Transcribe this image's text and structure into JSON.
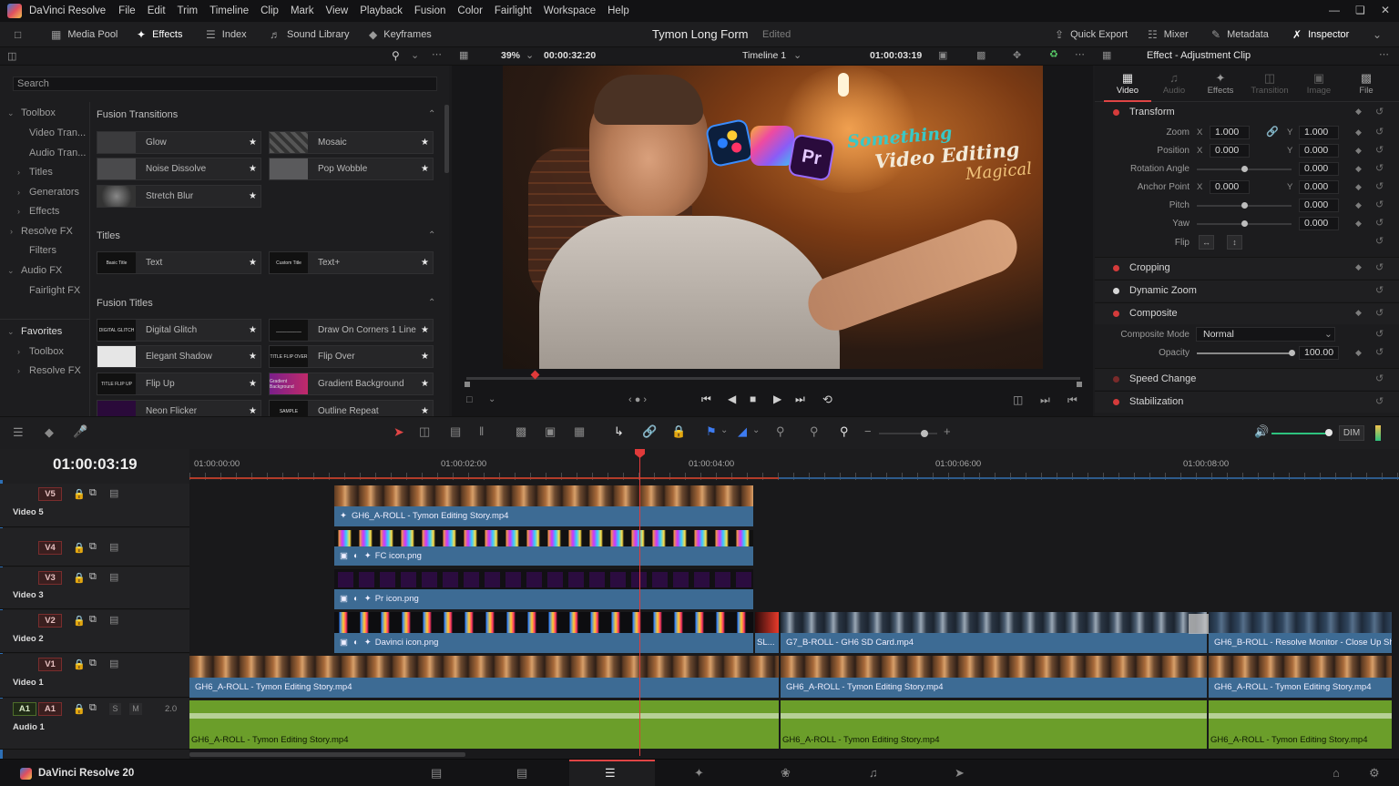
{
  "menubar": {
    "app_name": "DaVinci Resolve",
    "items": [
      "File",
      "Edit",
      "Trim",
      "Timeline",
      "Clip",
      "Mark",
      "View",
      "Playback",
      "Fusion",
      "Color",
      "Fairlight",
      "Workspace",
      "Help"
    ]
  },
  "toolbar": {
    "media_pool": "Media Pool",
    "effects": "Effects",
    "index": "Index",
    "sound_library": "Sound Library",
    "keyframes": "Keyframes",
    "project_title": "Tymon Long Form",
    "project_status": "Edited",
    "quick_export": "Quick Export",
    "mixer": "Mixer",
    "metadata": "Metadata",
    "inspector": "Inspector"
  },
  "viewer_bar": {
    "zoom": "39%",
    "source_timecode": "00:00:32:20",
    "timeline_name": "Timeline 1",
    "record_timecode": "01:00:03:19"
  },
  "effects_panel": {
    "search_placeholder": "Search",
    "tree": [
      {
        "label": "Toolbox",
        "caret": "v"
      },
      {
        "label": "Video Tran...",
        "caret": ""
      },
      {
        "label": "Audio Tran...",
        "caret": ""
      },
      {
        "label": "Titles",
        "caret": ">"
      },
      {
        "label": "Generators",
        "caret": ">"
      },
      {
        "label": "Effects",
        "caret": ">"
      },
      {
        "label": "Resolve FX",
        "caret": ">"
      },
      {
        "label": "Filters",
        "caret": ""
      },
      {
        "label": "Audio FX",
        "caret": "v"
      },
      {
        "label": "Fairlight FX",
        "caret": ""
      },
      {
        "label": "Favorites",
        "caret": "v"
      },
      {
        "label": "Toolbox",
        "caret": ">"
      },
      {
        "label": "Resolve FX",
        "caret": ">"
      }
    ],
    "sections": {
      "fusion_transitions": "Fusion Transitions",
      "titles": "Titles",
      "fusion_titles": "Fusion Titles"
    },
    "fusion_transitions": [
      "Glow",
      "Mosaic",
      "Noise Dissolve",
      "Pop Wobble",
      "Stretch Blur"
    ],
    "titles": [
      {
        "name": "Text",
        "thumb": "Basic Title"
      },
      {
        "name": "Text+",
        "thumb": "Custom Title"
      }
    ],
    "fusion_titles": [
      {
        "name": "Digital Glitch",
        "thumb": "DIGITAL GLITCH"
      },
      {
        "name": "Draw On Corners 1 Line",
        "thumb": "__________"
      },
      {
        "name": "Elegant Shadow",
        "thumb": ""
      },
      {
        "name": "Flip Over",
        "thumb": "TITLE FLIP OVER"
      },
      {
        "name": "Flip Up",
        "thumb": "TITLE FLIP UP"
      },
      {
        "name": "Gradient Background",
        "thumb": "Gradient Background"
      },
      {
        "name": "Neon Flicker",
        "thumb": ""
      },
      {
        "name": "Outline Repeat",
        "thumb": "SAMPLE"
      }
    ]
  },
  "overlay": {
    "something": "Something",
    "video_editing": "Video Editing",
    "magical": "Magical",
    "pr": "Pr"
  },
  "inspector": {
    "header": "Effect - Adjustment Clip",
    "tabs": [
      "Video",
      "Audio",
      "Effects",
      "Transition",
      "Image",
      "File"
    ],
    "transform_label": "Transform",
    "params": {
      "zoom_label": "Zoom",
      "zoom_x": "1.000",
      "zoom_y": "1.000",
      "position_label": "Position",
      "position_x": "0.000",
      "position_y": "0.000",
      "rotation_label": "Rotation Angle",
      "rotation": "0.000",
      "anchor_label": "Anchor Point",
      "anchor_x": "0.000",
      "anchor_y": "0.000",
      "pitch_label": "Pitch",
      "pitch": "0.000",
      "yaw_label": "Yaw",
      "yaw": "0.000",
      "flip_label": "Flip",
      "x": "X",
      "y": "Y"
    },
    "sections": [
      "Cropping",
      "Dynamic Zoom",
      "Composite",
      "Speed Change",
      "Stabilization"
    ],
    "composite_mode_label": "Composite Mode",
    "composite_mode": "Normal",
    "opacity_label": "Opacity",
    "opacity": "100.00"
  },
  "timeline": {
    "timecode": "01:00:03:19",
    "ruler": [
      "01:00:00:00",
      "01:00:02:00",
      "01:00:04:00",
      "01:00:06:00",
      "01:00:08:00"
    ],
    "dim_label": "DIM",
    "tracks": {
      "v5": "V5",
      "v5_name": "Video 5",
      "v4": "V4",
      "v3": "V3",
      "v3_name": "Video 3",
      "v2": "V2",
      "v2_name": "Video 2",
      "v1": "V1",
      "v1_name": "Video 1",
      "a1": "A1",
      "a1_name": "Audio 1",
      "a1_level": "2.0",
      "s": "S",
      "m": "M"
    },
    "clips": {
      "v5": "GH6_A-ROLL - Tymon Editing Story.mp4",
      "v4": "FC icon.png",
      "v3": "Pr icon.png",
      "v2a": "Davinci icon.png",
      "v2b": "SL...",
      "v2c": "G7_B-ROLL - GH6 SD Card.mp4",
      "v2d": "GH6_B-ROLL - Resolve Monitor - Close Up Sho...",
      "v1a": "GH6_A-ROLL - Tymon Editing Story.mp4",
      "v1b": "GH6_A-ROLL - Tymon Editing Story.mp4",
      "v1c": "GH6_A-ROLL - Tymon Editing Story.mp4",
      "a1a": "GH6_A-ROLL - Tymon Editing Story.mp4",
      "a1b": "GH6_A-ROLL - Tymon Editing Story.mp4",
      "a1c": "GH6_A-ROLL - Tymon Editing Story.mp4"
    }
  },
  "pagebar": {
    "product": "DaVinci Resolve 20"
  }
}
